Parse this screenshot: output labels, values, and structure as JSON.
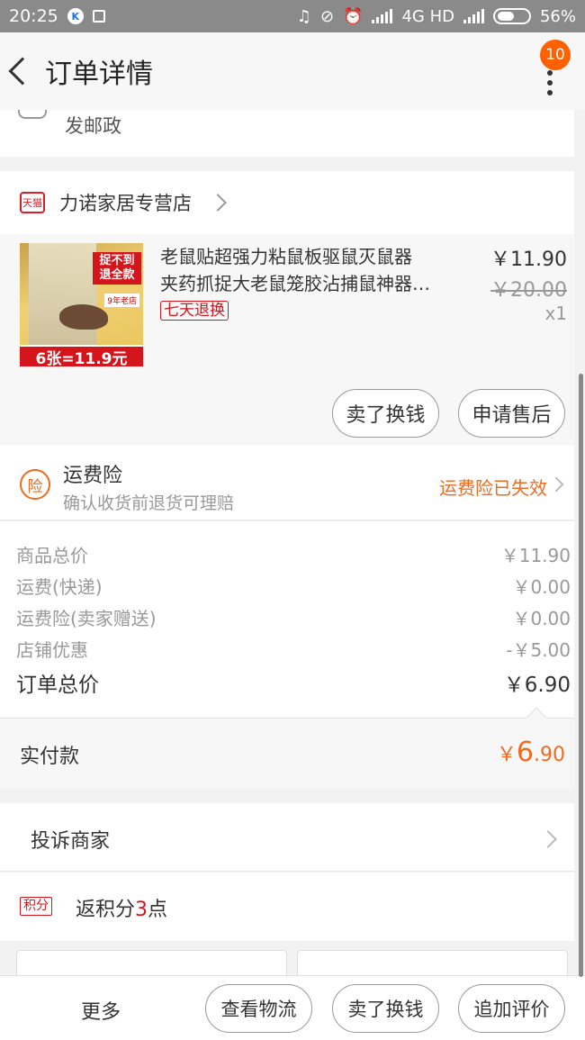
{
  "status_bar": {
    "time": "20:25",
    "network": "4G HD",
    "battery": "56%"
  },
  "header": {
    "title": "订单详情",
    "badge": "10"
  },
  "address_snippet": "发邮政",
  "store": {
    "icon_text": "天猫",
    "name": "力诺家居专营店"
  },
  "product": {
    "title_line1": "老鼠贴超强力粘鼠板驱鼠灭鼠器",
    "title_line2": "夹药抓捉大老鼠笼胶沾捕鼠神器…",
    "tag": "七天退换",
    "price": "￥11.90",
    "original_price": "￥20.00",
    "quantity": "x1",
    "image_text": {
      "tag": "捉不到退全款",
      "sub": "9年老店",
      "promo": "6张=11.9元"
    },
    "actions": {
      "sell": "卖了换钱",
      "after_sale": "申请售后"
    }
  },
  "insurance": {
    "icon": "险",
    "title": "运费险",
    "subtitle": "确认收货前退货可理赔",
    "status": "运费险已失效"
  },
  "summary": {
    "rows": [
      {
        "label": "商品总价",
        "value": "￥11.90"
      },
      {
        "label": "运费(快递)",
        "value": "￥0.00"
      },
      {
        "label": "运费险(卖家赠送)",
        "value": "￥0.00"
      },
      {
        "label": "店铺优惠",
        "value": "-￥5.00"
      }
    ],
    "total_label": "订单总价",
    "total_value": "￥6.90"
  },
  "paid": {
    "label": "实付款",
    "currency": "￥",
    "integer": "6",
    "decimal": ".90"
  },
  "complain": {
    "label": "投诉商家"
  },
  "points": {
    "icon": "积分",
    "prefix": "返积分",
    "number": "3",
    "suffix": "点"
  },
  "footer": {
    "more": "更多",
    "logistics": "查看物流",
    "sell": "卖了换钱",
    "review": "追加评价"
  },
  "colors": {
    "accent": "#f06a1f",
    "tmall_red": "#d4151c",
    "status_bar": "#8a8a8a"
  }
}
